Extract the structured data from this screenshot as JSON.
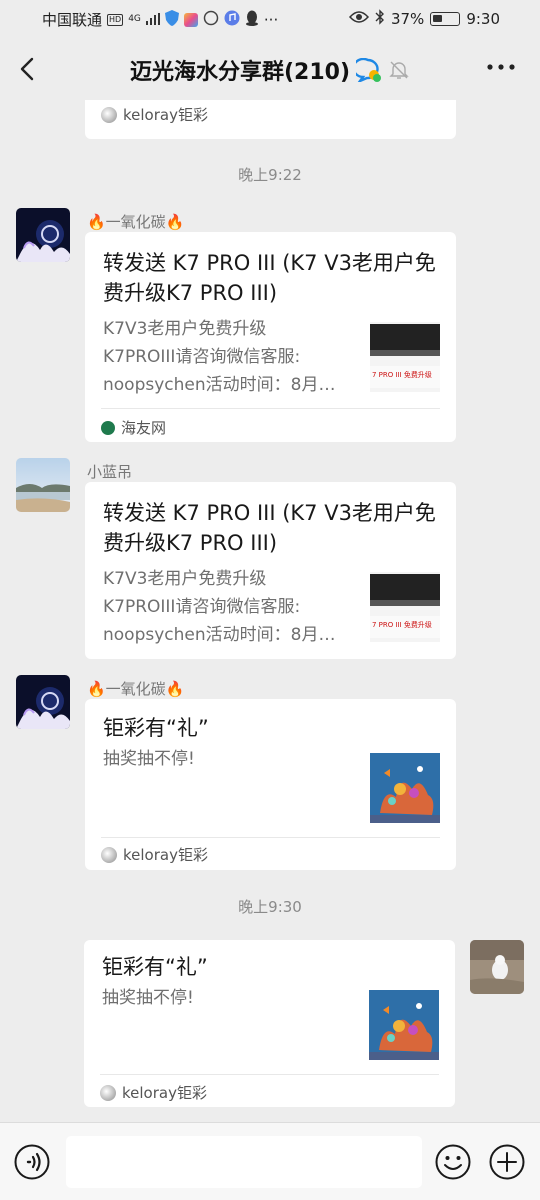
{
  "status_bar": {
    "carrier": "中国联通",
    "hd_badge": "HD",
    "network_badge": "4G",
    "more_dots": "···",
    "battery_text": "37%",
    "battery_level": 0.37,
    "time": "9:30"
  },
  "header": {
    "title": "迈光海水分享群(210)",
    "icons": [
      "back-arrow-icon",
      "chat-bubble-icon",
      "mute-bell-icon",
      "more-icon"
    ]
  },
  "messages": {
    "top_card_source": "keloray钜彩",
    "time_1": "晚上9:22",
    "msg1": {
      "sender": "🔥一氧化碳🔥",
      "title": "转发送 K7 PRO III (K7 V3老用户免费升级K7 PRO III)",
      "desc": "K7V3老用户免费升级\nK7PROIII请咨询微信客服:\nnoopsychen活动时间：8月…",
      "thumb_text": "7 PRO III 免费升级",
      "source": "海友网"
    },
    "msg2": {
      "sender": "小蓝吊",
      "title": "转发送 K7 PRO III (K7 V3老用户免费升级K7 PRO III)",
      "desc": "K7V3老用户免费升级\nK7PROIII请咨询微信客服:\nnoopsychen活动时间：8月…",
      "thumb_text": "7 PRO III 免费升级",
      "source": ""
    },
    "msg3": {
      "sender": "🔥一氧化碳🔥",
      "title": "钜彩有“礼”",
      "desc": "抽奖抽不停!",
      "source": "keloray钜彩"
    },
    "time_2": "晚上9:30",
    "msg4": {
      "title": "钜彩有“礼”",
      "desc": "抽奖抽不停!",
      "source": "keloray钜彩"
    }
  },
  "input_bar": {
    "placeholder": "",
    "icons": [
      "voice-icon",
      "emoji-icon",
      "plus-icon"
    ]
  },
  "colors": {
    "background": "#ededed",
    "card": "#ffffff",
    "accent": "#1e88e5"
  }
}
